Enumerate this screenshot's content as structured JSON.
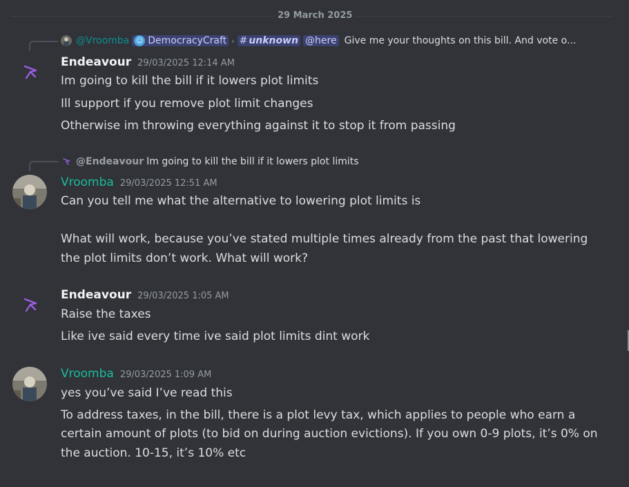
{
  "date_divider": "29 March 2025",
  "messages": [
    {
      "reply": {
        "author": "@Vroomba",
        "server_pill": "DemocracyCraft",
        "channel_pill": "unknown",
        "mention_pill": "@here",
        "text": "Give me your thoughts on this bill. And vote o..."
      },
      "author": "Endeavour",
      "timestamp": "29/03/2025 12:14 AM",
      "lines": [
        "Im going to kill the bill if it lowers plot limits",
        "Ill support if you remove plot limit changes",
        "Otherwise im throwing everything against it to stop it from passing"
      ]
    },
    {
      "reply": {
        "author": "@Endeavour",
        "text": "Im going to kill the bill if it lowers plot limits"
      },
      "author": "Vroomba",
      "timestamp": "29/03/2025 12:51 AM",
      "lines": [
        "Can you tell me what the alternative to lowering plot limits is",
        "What will work, because you’ve stated multiple times already from the past that lowering",
        "the plot limits don’t work. What will work?"
      ]
    },
    {
      "author": "Endeavour",
      "timestamp": "29/03/2025 1:05 AM",
      "lines": [
        "Raise the taxes",
        "Like ive said every time ive said plot limits dint work"
      ]
    },
    {
      "author": "Vroomba",
      "timestamp": "29/03/2025 1:09 AM",
      "lines": [
        "yes you’ve said I’ve read this",
        "To address taxes, in the bill, there is a plot levy tax, which applies to people who earn a",
        "certain amount of plots (to bid on during auction evictions). If you own 0-9 plots, it’s 0% on",
        "the auction. 10-15, it’s 10% etc"
      ]
    }
  ],
  "icons": {
    "endeavour_avatar": "purple-arrow-logo-icon",
    "vroomba_avatar": "user-photo-avatar"
  },
  "colors": {
    "background": "#313338",
    "vroomba_name": "#1abc9c",
    "endeavour_logo": "#9b5de5",
    "mention_pill": "#3c4270"
  }
}
